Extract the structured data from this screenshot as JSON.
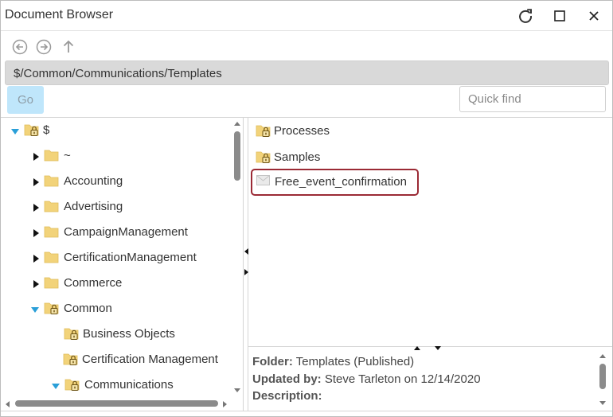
{
  "window": {
    "title": "Document Browser"
  },
  "navigation": {
    "path": "$/Common/Communications/Templates",
    "go_label": "Go",
    "quick_find_placeholder": "Quick find"
  },
  "tree": {
    "root": "$",
    "items": [
      {
        "label": "~"
      },
      {
        "label": "Accounting"
      },
      {
        "label": "Advertising"
      },
      {
        "label": "CampaignManagement"
      },
      {
        "label": "CertificationManagement"
      },
      {
        "label": "Commerce"
      },
      {
        "label": "Common"
      },
      {
        "label": "Business Objects"
      },
      {
        "label": "Certification Management"
      },
      {
        "label": "Communications"
      }
    ]
  },
  "files": {
    "items": [
      {
        "label": "Processes",
        "icon": "locked-folder-icon"
      },
      {
        "label": "Samples",
        "icon": "locked-folder-icon"
      },
      {
        "label": "Free_event_confirmation",
        "icon": "email-template-icon"
      }
    ]
  },
  "details": {
    "folder_label": "Folder:",
    "folder_value": "Templates (Published)",
    "updated_label": "Updated by:",
    "updated_value": "Steve Tarleton on 12/14/2020",
    "description_label": "Description:",
    "description_value": ""
  },
  "colors": {
    "tree_toggle_expanded": "#2a9fd8",
    "folder": "#f2d37a",
    "lock": "#8a6d1c",
    "selected_outline": "#9b2a35",
    "go_button_bg": "#bfe6fb",
    "path_bar_bg": "#d9d9d9"
  }
}
